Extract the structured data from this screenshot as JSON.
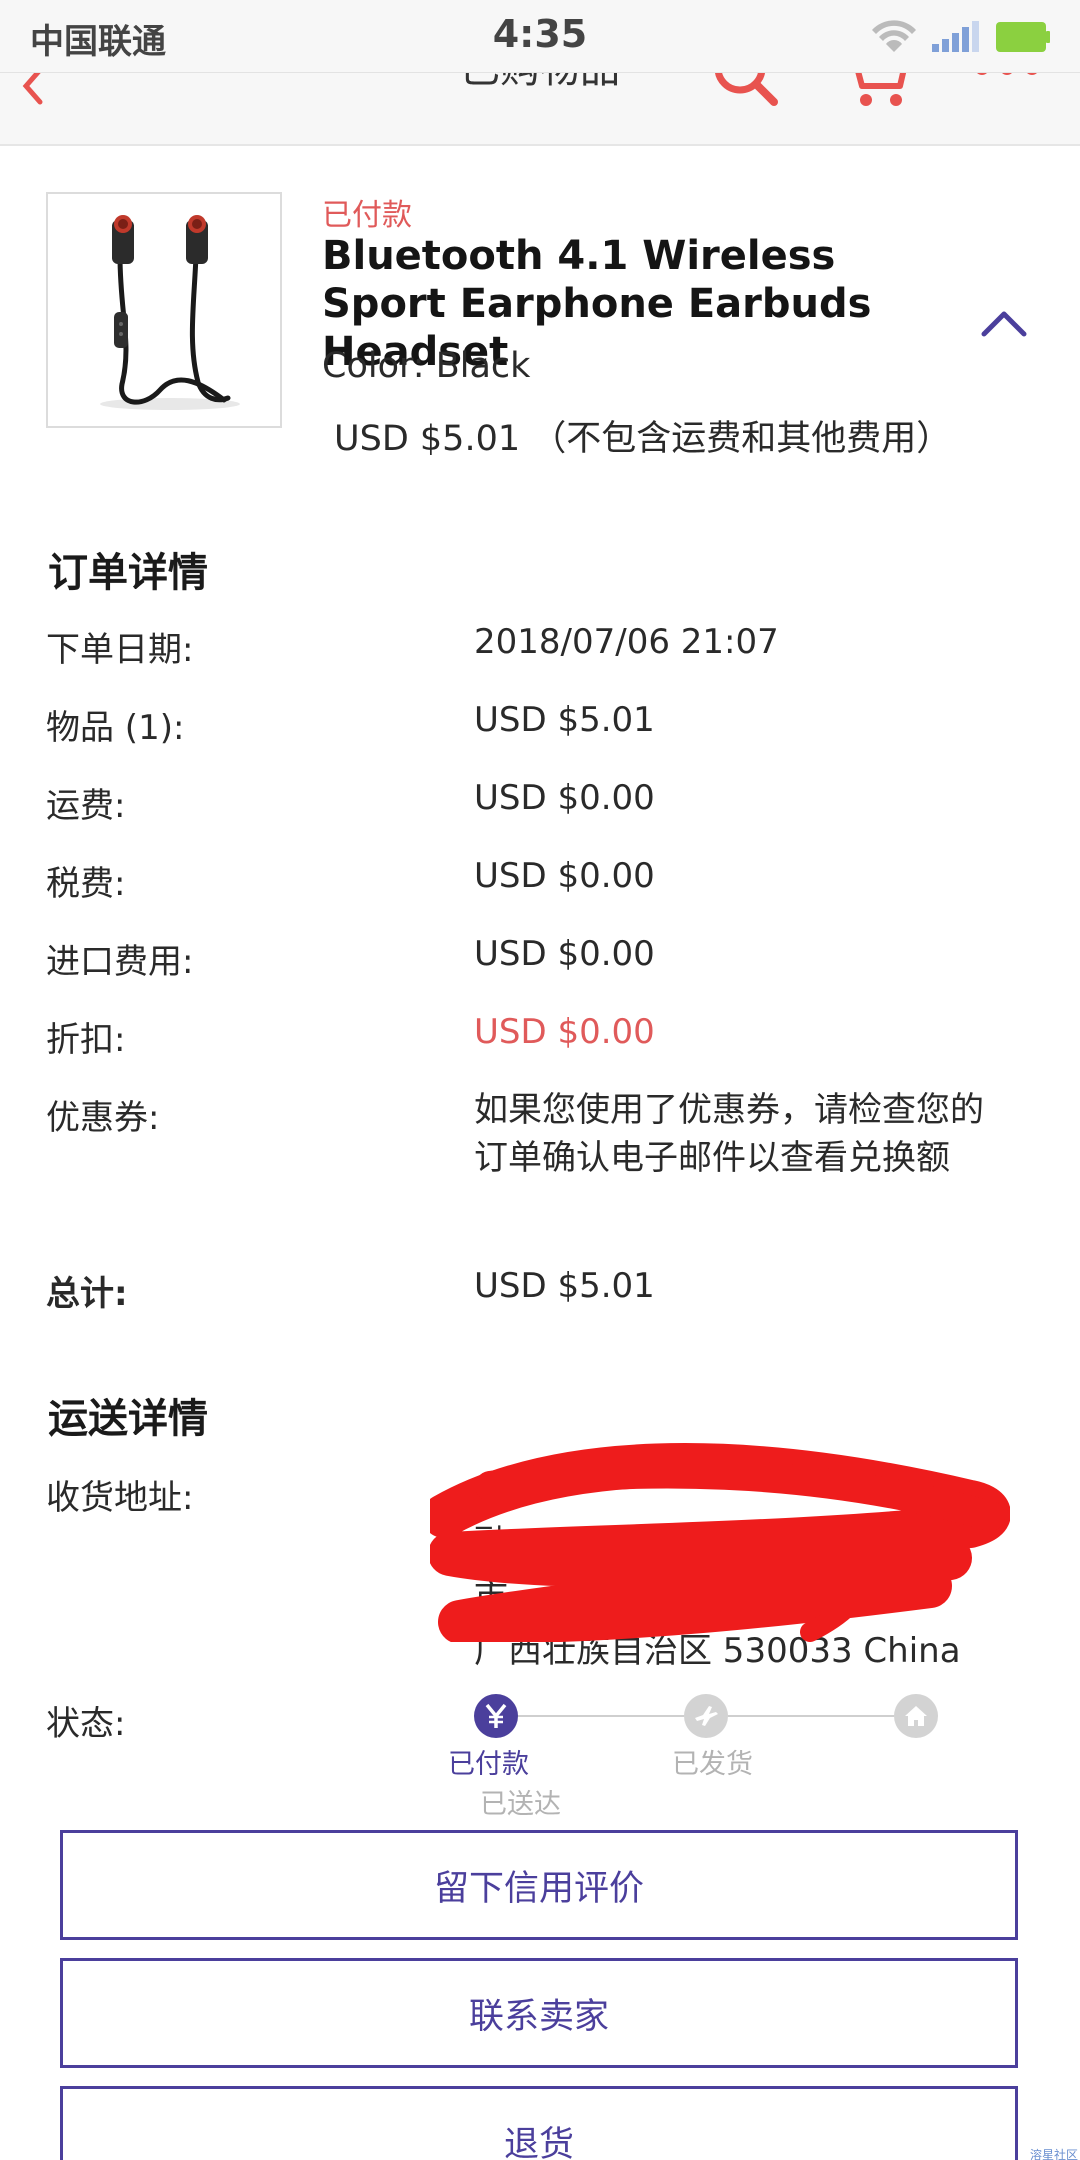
{
  "status_bar": {
    "carrier": "中国联通",
    "time": "4:35"
  },
  "nav": {
    "title": "已购物品"
  },
  "item": {
    "status": "已付款",
    "title": "Bluetooth 4.1 Wireless Sport Earphone Earbuds Headset",
    "color_label": "Color:",
    "color_value": "Black",
    "price": "USD $5.01",
    "price_note": "（不包含运费和其他费用）"
  },
  "order_details": {
    "heading": "订单详情",
    "rows": [
      {
        "label": "下单日期:",
        "value": "2018/07/06 21:07"
      },
      {
        "label": "物品 (1):",
        "value": "USD $5.01"
      },
      {
        "label": "运费:",
        "value": "USD $0.00"
      },
      {
        "label": "税费:",
        "value": "USD $0.00"
      },
      {
        "label": "进口费用:",
        "value": "USD $0.00"
      },
      {
        "label": "折扣:",
        "value": "USD $0.00"
      },
      {
        "label": "优惠券:",
        "value": "如果您使用了优惠券，请检查您的订单确认电子邮件以查看兑换额"
      },
      {
        "label": "总计:",
        "value": "USD $5.01"
      }
    ]
  },
  "shipping_details": {
    "heading": "运送详情",
    "address_label": "收货地址:",
    "address_lines": [
      "融",
      "市",
      "广西壮族自治区 530033 China"
    ],
    "status_label": "状态:",
    "steps": [
      {
        "label": "已付款",
        "icon": "yen-icon",
        "active": true
      },
      {
        "label": "已发货",
        "icon": "plane-icon",
        "active": false
      },
      {
        "label": "已送达",
        "icon": "home-icon",
        "active": false
      }
    ]
  },
  "actions": {
    "leave_feedback": "留下信用评价",
    "contact_seller": "联系卖家",
    "return_item": "退货"
  },
  "watermark": "溶星社区",
  "colors": {
    "accent": "#4b3f9c",
    "sale_red": "#e05a5a",
    "nav_red": "#e8534f"
  }
}
